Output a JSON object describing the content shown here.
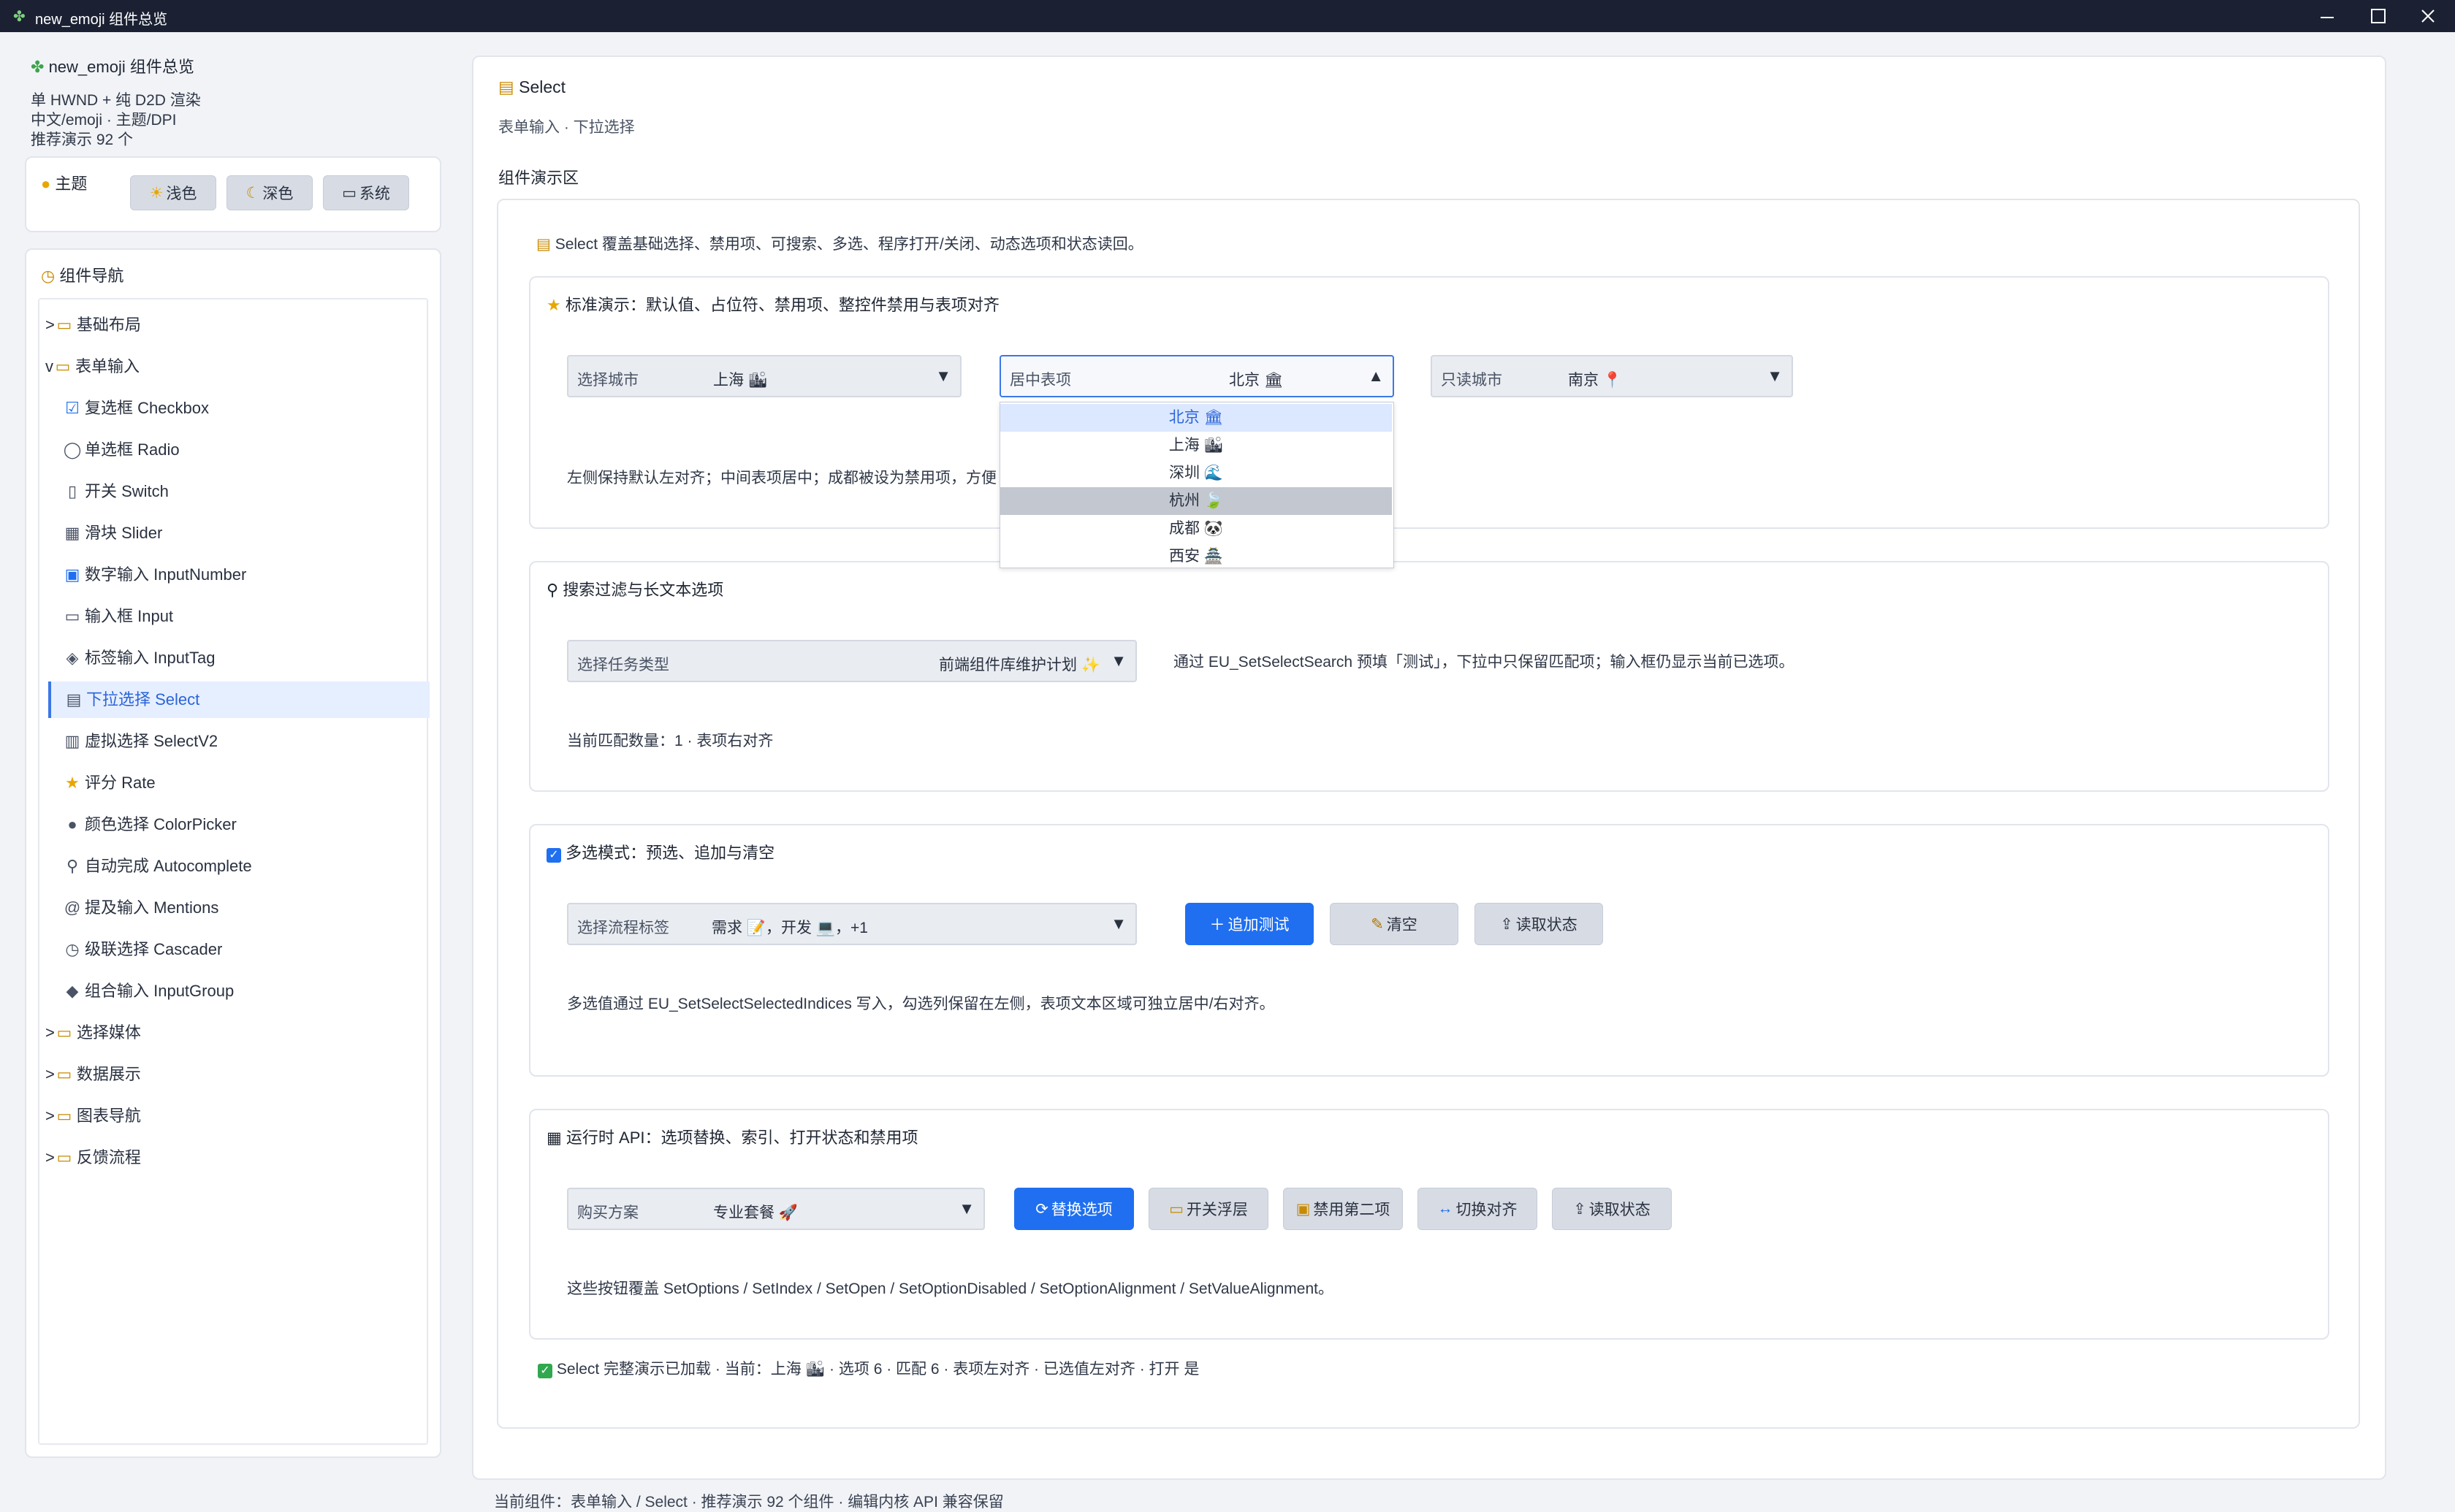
{
  "window": {
    "title": "new_emoji 组件总览"
  },
  "sidebar": {
    "app_title": "new_emoji 组件总览",
    "desc_lines": [
      "单 HWND + 纯 D2D 渲染",
      "中文/emoji · 主题/DPI",
      "推荐演示 92 个"
    ],
    "theme": {
      "label": "主题",
      "buttons": [
        "浅色",
        "深色",
        "系统"
      ]
    },
    "nav_title": "组件导航",
    "groups_top": [
      {
        "arrow": ">",
        "label": "基础布局"
      },
      {
        "arrow": "v",
        "label": "表单输入"
      }
    ],
    "items": [
      {
        "label": "复选框 Checkbox",
        "icon": "☑"
      },
      {
        "label": "单选框 Radio",
        "icon": "◯"
      },
      {
        "label": "开关 Switch",
        "icon": "▯"
      },
      {
        "label": "滑块 Slider",
        "icon": "▦"
      },
      {
        "label": "数字输入 InputNumber",
        "icon": "▣"
      },
      {
        "label": "输入框 Input",
        "icon": "▭"
      },
      {
        "label": "标签输入 InputTag",
        "icon": "◈"
      },
      {
        "label": "下拉选择 Select",
        "icon": "▤"
      },
      {
        "label": "虚拟选择 SelectV2",
        "icon": "▥"
      },
      {
        "label": "评分 Rate",
        "icon": "★"
      },
      {
        "label": "颜色选择 ColorPicker",
        "icon": "●"
      },
      {
        "label": "自动完成 Autocomplete",
        "icon": "⚲"
      },
      {
        "label": "提及输入 Mentions",
        "icon": "@"
      },
      {
        "label": "级联选择 Cascader",
        "icon": "◷"
      },
      {
        "label": "组合输入 InputGroup",
        "icon": "◆"
      }
    ],
    "groups_bottom": [
      {
        "arrow": ">",
        "label": "选择媒体"
      },
      {
        "arrow": ">",
        "label": "数据展示"
      },
      {
        "arrow": ">",
        "label": "图表导航"
      },
      {
        "arrow": ">",
        "label": "反馈流程"
      }
    ]
  },
  "main": {
    "title": "Select",
    "breadcrumb": "表单输入 · 下拉选择",
    "demo_area_label": "组件演示区",
    "intro": "Select 覆盖基础选择、禁用项、可搜索、多选、程序打开/关闭、动态选项和状态读回。",
    "sec1": {
      "title": "标准演示：默认值、占位符、禁用项、整控件禁用与表项对齐",
      "sel1": {
        "placeholder": "选择城市",
        "value": "上海 🏙"
      },
      "sel2": {
        "placeholder": "居中表项",
        "value": "北京 🏛"
      },
      "sel3": {
        "placeholder": "只读城市",
        "value": "南京 📍"
      },
      "note": "左侧保持默认左对齐；中间表项居中；成都被设为禁用项，方便",
      "dropdown": [
        "北京 🏛",
        "上海 🏙",
        "深圳 🌊",
        "杭州 🍃",
        "成都 🐼",
        "西安 🏯"
      ]
    },
    "sec2": {
      "title": "搜索过滤与长文本选项",
      "sel": {
        "placeholder": "选择任务类型",
        "value": "前端组件库维护计划 ✨"
      },
      "note": "通过 EU_SetSelectSearch 预填「测试」，下拉中只保留匹配项；输入框仍显示当前已选项。",
      "count": "当前匹配数量：1 · 表项右对齐"
    },
    "sec3": {
      "title": "多选模式：预选、追加与清空",
      "sel": {
        "placeholder": "选择流程标签",
        "value": "需求 📝，开发 💻，+1"
      },
      "buttons": [
        "追加测试",
        "清空",
        "读取状态"
      ],
      "note": "多选值通过 EU_SetSelectSelectedIndices 写入，勾选列保留在左侧，表项文本区域可独立居中/右对齐。"
    },
    "sec4": {
      "title": "运行时 API：选项替换、索引、打开状态和禁用项",
      "sel": {
        "placeholder": "购买方案",
        "value": "专业套餐 🚀"
      },
      "buttons": [
        "替换选项",
        "开关浮层",
        "禁用第二项",
        "切换对齐",
        "读取状态"
      ],
      "note": "这些按钮覆盖 SetOptions / SetIndex / SetOpen / SetOptionDisabled / SetOptionAlignment / SetValueAlignment。"
    },
    "status": "Select 完整演示已加载 · 当前：上海 🏙 · 选项 6 · 匹配 6 · 表项左对齐 · 已选值左对齐 · 打开 是"
  },
  "footer": {
    "text": "当前组件：表单输入 / Select · 推荐演示 92 个组件 · 编辑内核 API 兼容保留"
  }
}
